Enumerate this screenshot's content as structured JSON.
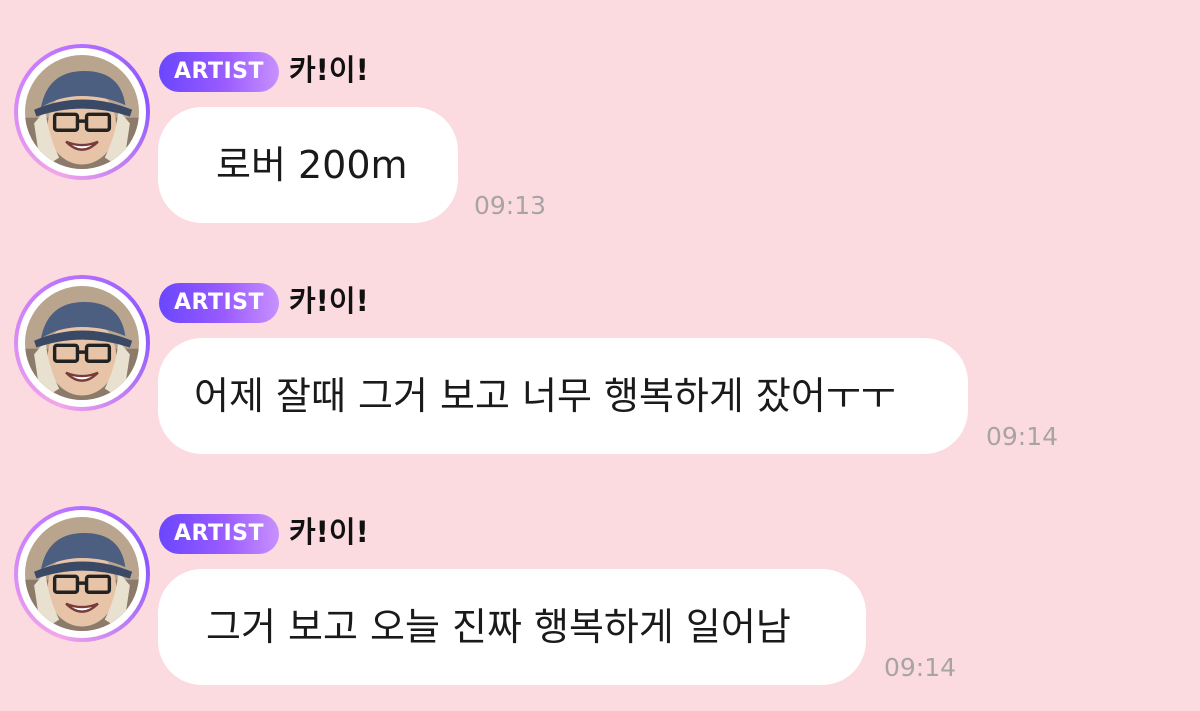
{
  "messages": [
    {
      "badge": "ARTIST",
      "sender": "카!이!",
      "text": "로버 200m",
      "time": "09:13"
    },
    {
      "badge": "ARTIST",
      "sender": "카!이!",
      "text": "어제 잘때 그거 보고 너무 행복하게 잤어ㅜㅜ",
      "time": "09:14"
    },
    {
      "badge": "ARTIST",
      "sender": "카!이!",
      "text": "그거 보고 오늘 진짜 행복하게 일어남",
      "time": "09:14"
    }
  ],
  "colors": {
    "background": "#fbdbe0",
    "bubble": "#ffffff",
    "badge_start": "#6a46ff",
    "badge_end": "#c890ff",
    "timestamp": "#a8a3a5"
  },
  "icons": {
    "avatar": "artist-profile-photo"
  }
}
